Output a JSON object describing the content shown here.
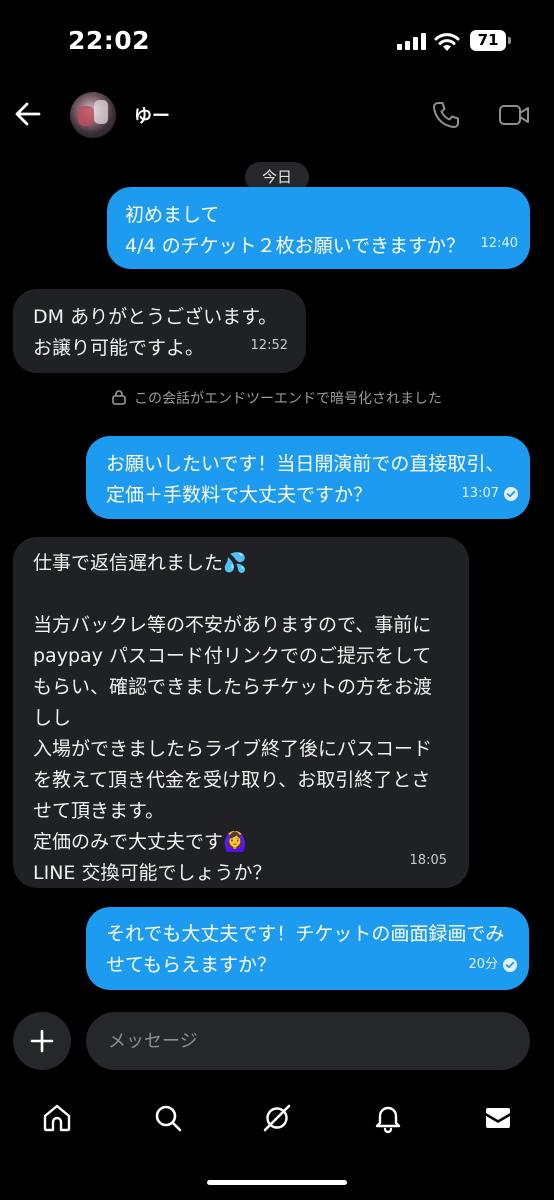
{
  "status_bar": {
    "time": "22:02",
    "battery": "71"
  },
  "header": {
    "contact_name": "ゆー",
    "icons": [
      "back-arrow-icon",
      "phone-icon",
      "video-camera-icon"
    ]
  },
  "conversation": {
    "date_label": "今日",
    "encryption_notice": "この会話がエンドツーエンドで暗号化されました",
    "messages": [
      {
        "direction": "sent",
        "text": "初めまして\n4/4 のチケット２枚お願いできますか？",
        "time": "12:40",
        "read": false
      },
      {
        "direction": "received",
        "text": "DM ありがとうございます。\nお譲り可能ですよ。",
        "time": "12:52"
      },
      {
        "direction": "sent",
        "text": "お願いしたいです！当日開演前での直接取引、\n定価＋手数料で大丈夫ですか？",
        "time": "13:07",
        "read": true
      },
      {
        "direction": "received",
        "text": "仕事で返信遅れました💦\n\n当方バックレ等の不安がありますので、事前に\npaypay パスコード付リンクでのご提示をして\nもらい、確認できましたらチケットの方をお渡\nしし\n入場ができましたらライブ終了後にパスコード\nを教えて頂き代金を受け取り、お取引終了とさ\nせて頂きます。\n定価のみで大丈夫です🙆‍♀️\nLINE 交換可能でしょうか？",
        "time": "18:05"
      },
      {
        "direction": "sent",
        "text": "それでも大丈夫です！チケットの画面録画でみ\nせてもらえますか？",
        "time": "20分",
        "read": true
      }
    ]
  },
  "composer": {
    "placeholder": "メッセージ"
  },
  "bottom_nav": {
    "items": [
      "home-icon",
      "search-icon",
      "grok-icon",
      "notifications-bell-icon",
      "messages-envelope-icon"
    ]
  },
  "colors": {
    "background": "#000000",
    "sent_bubble": "#1d9bf0",
    "received_bubble": "#202124"
  }
}
